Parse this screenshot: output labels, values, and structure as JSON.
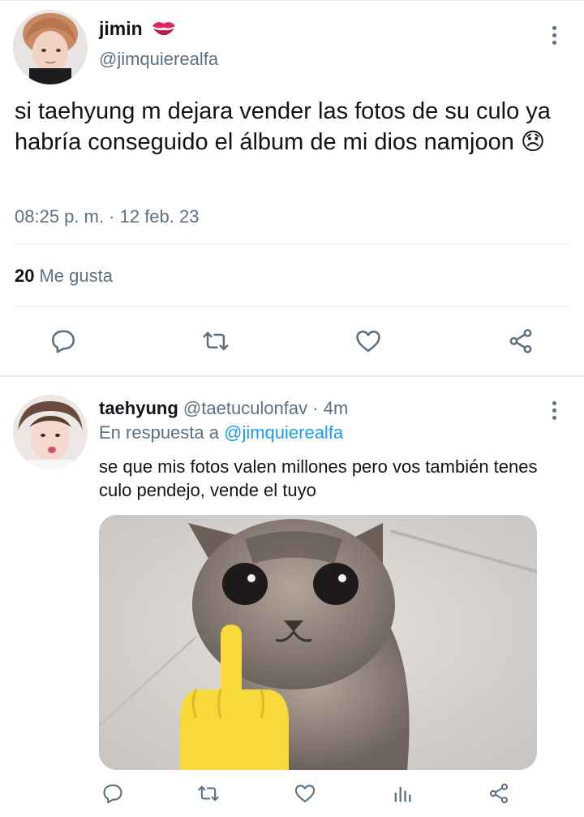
{
  "main_tweet": {
    "author_name": "jimin",
    "author_emoji": "💋",
    "author_handle": "@jimquierealfa",
    "text": "si taehyung m dejara vender las fotos de su culo ya habría conseguido el álbum de mi dios namjoon 😞",
    "timestamp": "08:25 p. m. · 12 feb. 23",
    "likes_count": "20",
    "likes_label": "Me gusta",
    "actions": [
      "reply-icon",
      "retweet-icon",
      "like-icon",
      "share-icon"
    ],
    "more_icon": "more-vertical-icon"
  },
  "reply_tweet": {
    "author_name": "taehyung",
    "author_handle": "@taetuculonfav",
    "time_separator": "·",
    "time": "4m",
    "in_reply_to_label": "En respuesta a",
    "in_reply_to_handle": "@jimquierealfa",
    "text": "se que mis fotos valen millones pero vos también tenes culo pendejo, vende el tuyo",
    "actions": [
      "reply-icon",
      "retweet-icon",
      "like-icon",
      "analytics-icon",
      "share-icon"
    ],
    "more_icon": "more-vertical-icon"
  },
  "colors": {
    "text_primary": "#0f1419",
    "text_secondary": "#5b7083",
    "link": "#1d9bf0",
    "divider": "#e6ecf0",
    "emoji_kiss": "#e0245e"
  }
}
